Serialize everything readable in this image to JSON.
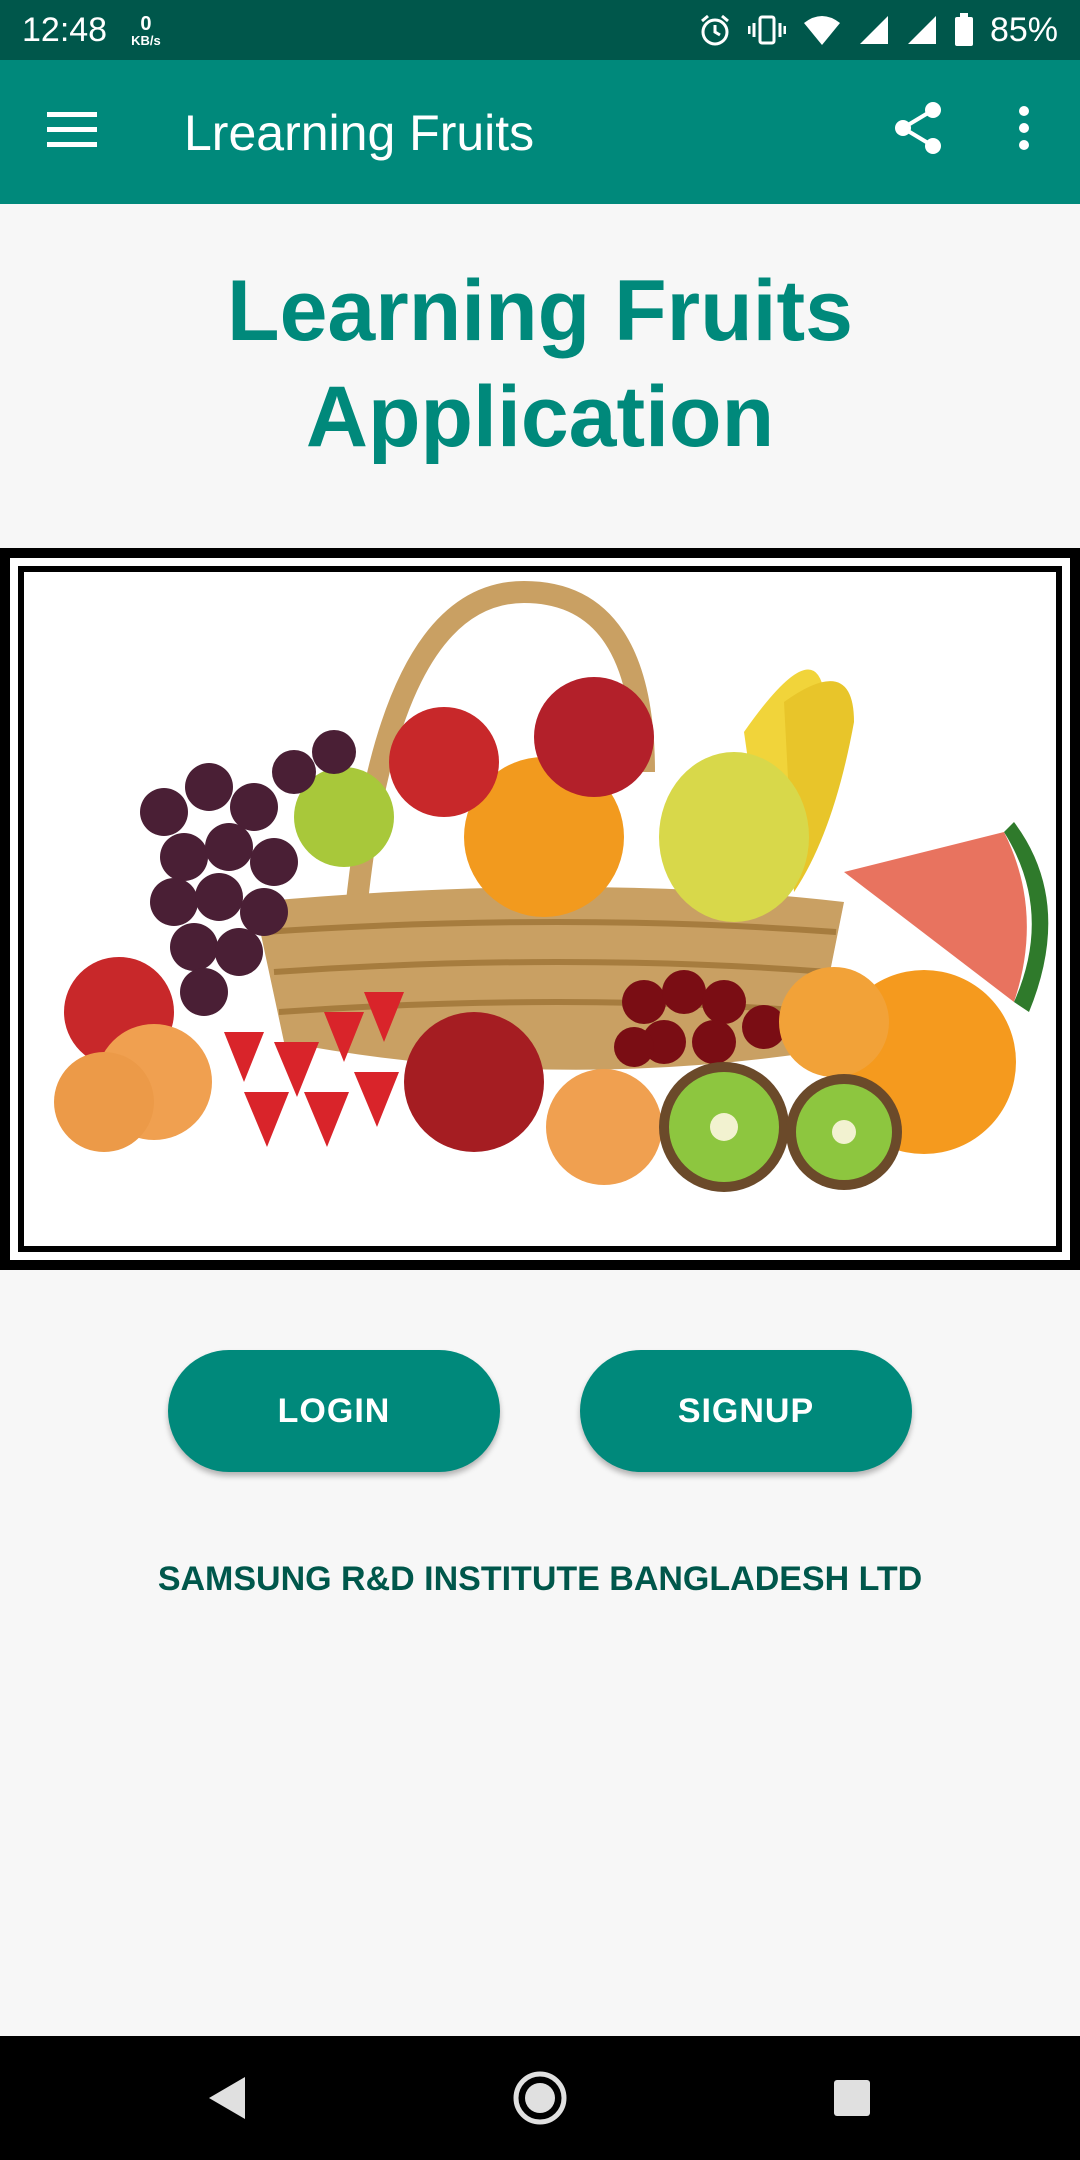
{
  "status_bar": {
    "time": "12:48",
    "net_speed_value": "0",
    "net_speed_unit": "KB/s",
    "battery_percent": "85%",
    "icons": [
      "alarm-icon",
      "vibrate-icon",
      "wifi-icon",
      "signal-icon",
      "signal-icon",
      "battery-icon"
    ]
  },
  "app_bar": {
    "title": "Lrearning Fruits",
    "icons": [
      "menu-icon",
      "share-icon",
      "more-vert-icon"
    ]
  },
  "main": {
    "headline_line1": "Learning Fruits",
    "headline_line2": "Application",
    "image": "fruit-basket-image",
    "login_label": "LOGIN",
    "signup_label": "SIGNUP",
    "company": "SAMSUNG R&D INSTITUTE BANGLADESH LTD"
  },
  "nav_bar": {
    "icons": [
      "back-icon",
      "home-icon",
      "recents-icon"
    ]
  },
  "colors": {
    "status_bar": "#00574b",
    "app_bar": "#00897b",
    "accent": "#00897b",
    "background": "#f7f7f7"
  }
}
